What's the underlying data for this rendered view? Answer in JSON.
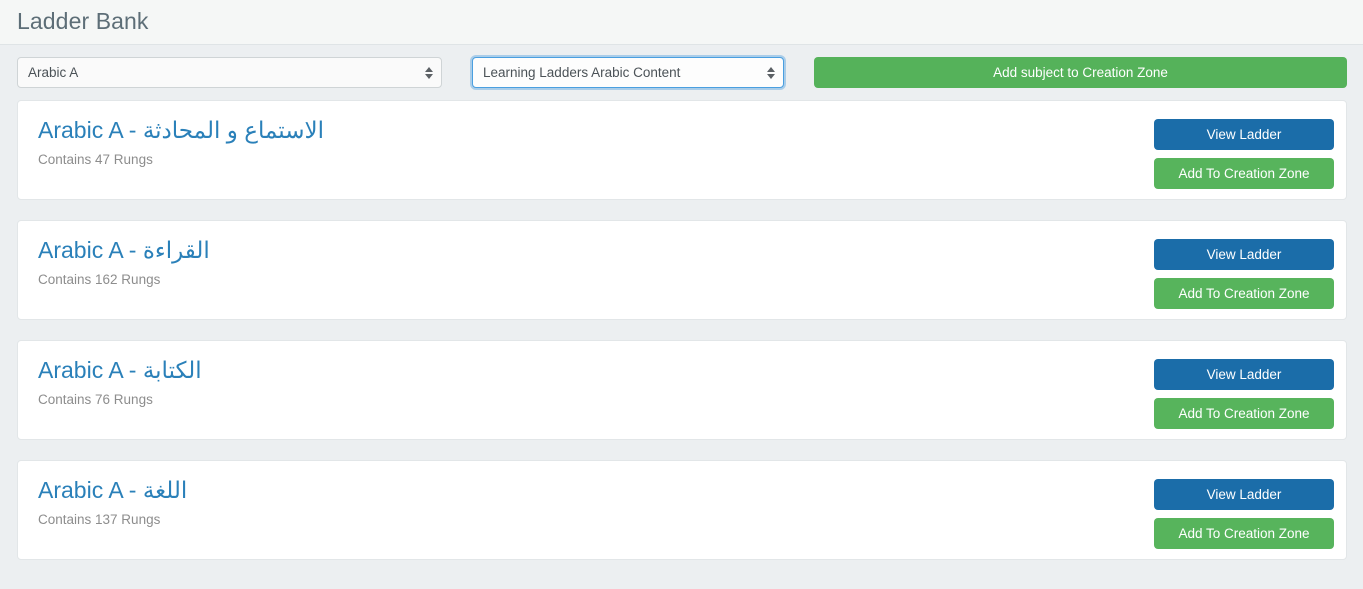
{
  "header": {
    "title": "Ladder Bank"
  },
  "toolbar": {
    "subject_select": {
      "value": "Arabic A",
      "icon": "spinner-arrows-icon",
      "focused": false
    },
    "content_select": {
      "value": "Learning Ladders Arabic Content",
      "icon": "spinner-arrows-icon",
      "focused": true
    },
    "add_subject_button": "Add subject to Creation Zone"
  },
  "colors": {
    "accent_blue": "#2a80b9",
    "button_blue": "#1b6da9",
    "button_green": "#57b45c",
    "toolbar_green": "#55b25a",
    "page_background": "#eceff1",
    "header_background": "#f5f7f6",
    "card_background": "#ffffff",
    "muted_text": "#8d8d8d",
    "heading_text": "#5d6e77"
  },
  "card_actions": {
    "view_label": "View Ladder",
    "add_label": "Add To Creation Zone"
  },
  "ladders": [
    {
      "title": "Arabic A - الاستماع و المحادثة",
      "rungs": "Contains 47 Rungs"
    },
    {
      "title": "Arabic A - القراءة",
      "rungs": "Contains 162 Rungs"
    },
    {
      "title": "Arabic A - الكتابة",
      "rungs": "Contains 76 Rungs"
    },
    {
      "title": "Arabic A - اللغة",
      "rungs": "Contains 137 Rungs"
    }
  ]
}
